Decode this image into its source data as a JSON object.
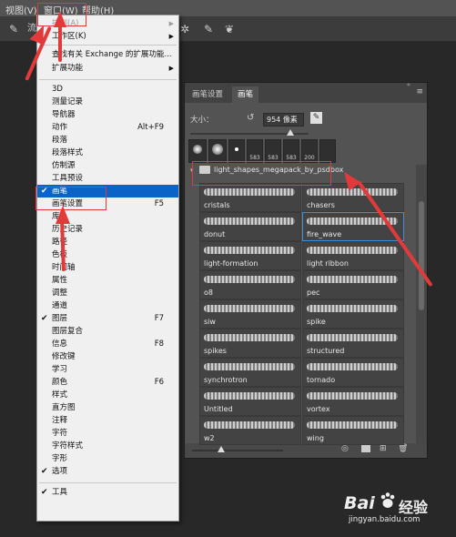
{
  "menubar": {
    "items": [
      "视图(V)",
      "窗口(W)",
      "帮助(H)"
    ]
  },
  "options_bar": {
    "partial_label": "流"
  },
  "menu": {
    "items": [
      {
        "label": "排列(A)",
        "shortcut": "",
        "submenu": true,
        "disabled": true,
        "checked": false,
        "selected": false
      },
      {
        "label": "工作区(K)",
        "shortcut": "",
        "submenu": true,
        "disabled": false,
        "checked": false,
        "selected": false
      },
      {
        "label": "查找有关 Exchange 的扩展功能...",
        "shortcut": "",
        "submenu": false,
        "disabled": false,
        "checked": false,
        "selected": false
      },
      {
        "label": "扩展功能",
        "shortcut": "",
        "submenu": true,
        "disabled": false,
        "checked": false,
        "selected": false
      },
      {
        "label": "3D",
        "shortcut": "",
        "submenu": false,
        "disabled": false,
        "checked": false,
        "selected": false
      },
      {
        "label": "测量记录",
        "shortcut": "",
        "submenu": false,
        "disabled": false,
        "checked": false,
        "selected": false
      },
      {
        "label": "导航器",
        "shortcut": "",
        "submenu": false,
        "disabled": false,
        "checked": false,
        "selected": false
      },
      {
        "label": "动作",
        "shortcut": "Alt+F9",
        "submenu": false,
        "disabled": false,
        "checked": false,
        "selected": false
      },
      {
        "label": "段落",
        "shortcut": "",
        "submenu": false,
        "disabled": false,
        "checked": false,
        "selected": false
      },
      {
        "label": "段落样式",
        "shortcut": "",
        "submenu": false,
        "disabled": false,
        "checked": false,
        "selected": false
      },
      {
        "label": "仿制源",
        "shortcut": "",
        "submenu": false,
        "disabled": false,
        "checked": false,
        "selected": false
      },
      {
        "label": "工具预设",
        "shortcut": "",
        "submenu": false,
        "disabled": false,
        "checked": false,
        "selected": false
      },
      {
        "label": "画笔",
        "shortcut": "",
        "submenu": false,
        "disabled": false,
        "checked": true,
        "selected": true
      },
      {
        "label": "画笔设置",
        "shortcut": "F5",
        "submenu": false,
        "disabled": false,
        "checked": false,
        "selected": false
      },
      {
        "label": "库",
        "shortcut": "",
        "submenu": false,
        "disabled": false,
        "checked": false,
        "selected": false
      },
      {
        "label": "历史记录",
        "shortcut": "",
        "submenu": false,
        "disabled": false,
        "checked": false,
        "selected": false
      },
      {
        "label": "路径",
        "shortcut": "",
        "submenu": false,
        "disabled": false,
        "checked": false,
        "selected": false
      },
      {
        "label": "色板",
        "shortcut": "",
        "submenu": false,
        "disabled": false,
        "checked": false,
        "selected": false
      },
      {
        "label": "时间轴",
        "shortcut": "",
        "submenu": false,
        "disabled": false,
        "checked": false,
        "selected": false
      },
      {
        "label": "属性",
        "shortcut": "",
        "submenu": false,
        "disabled": false,
        "checked": false,
        "selected": false
      },
      {
        "label": "调整",
        "shortcut": "",
        "submenu": false,
        "disabled": false,
        "checked": false,
        "selected": false
      },
      {
        "label": "通道",
        "shortcut": "",
        "submenu": false,
        "disabled": false,
        "checked": false,
        "selected": false
      },
      {
        "label": "图层",
        "shortcut": "F7",
        "submenu": false,
        "disabled": false,
        "checked": true,
        "selected": false
      },
      {
        "label": "图层复合",
        "shortcut": "",
        "submenu": false,
        "disabled": false,
        "checked": false,
        "selected": false
      },
      {
        "label": "信息",
        "shortcut": "F8",
        "submenu": false,
        "disabled": false,
        "checked": false,
        "selected": false
      },
      {
        "label": "修改键",
        "shortcut": "",
        "submenu": false,
        "disabled": false,
        "checked": false,
        "selected": false
      },
      {
        "label": "学习",
        "shortcut": "",
        "submenu": false,
        "disabled": false,
        "checked": false,
        "selected": false
      },
      {
        "label": "颜色",
        "shortcut": "F6",
        "submenu": false,
        "disabled": false,
        "checked": false,
        "selected": false
      },
      {
        "label": "样式",
        "shortcut": "",
        "submenu": false,
        "disabled": false,
        "checked": false,
        "selected": false
      },
      {
        "label": "直方图",
        "shortcut": "",
        "submenu": false,
        "disabled": false,
        "checked": false,
        "selected": false
      },
      {
        "label": "注释",
        "shortcut": "",
        "submenu": false,
        "disabled": false,
        "checked": false,
        "selected": false
      },
      {
        "label": "字符",
        "shortcut": "",
        "submenu": false,
        "disabled": false,
        "checked": false,
        "selected": false
      },
      {
        "label": "字符样式",
        "shortcut": "",
        "submenu": false,
        "disabled": false,
        "checked": false,
        "selected": false
      },
      {
        "label": "字形",
        "shortcut": "",
        "submenu": false,
        "disabled": false,
        "checked": false,
        "selected": false
      },
      {
        "label": "选项",
        "shortcut": "",
        "submenu": false,
        "disabled": false,
        "checked": true,
        "selected": false
      },
      {
        "label": "工具",
        "shortcut": "",
        "submenu": false,
        "disabled": false,
        "checked": true,
        "selected": false
      }
    ]
  },
  "panel": {
    "tabs": [
      "画笔设置",
      "画笔"
    ],
    "active_tab": "画笔",
    "size_label": "大小：",
    "size_value": "954 像素",
    "tip_numbers": [
      "583",
      "583",
      "583",
      "200"
    ],
    "folder_name": "light_shapes_megapack_by_psdbox",
    "brushes": [
      "cristals",
      "chasers",
      "donut",
      "fire_wave",
      "light-formation",
      "light ribbon",
      "o8",
      "pec",
      "siw",
      "spike",
      "spikes",
      "structured",
      "synchrotron",
      "tornado",
      "Untitled",
      "vortex",
      "w2",
      "wing"
    ],
    "selected_brush": "fire_wave"
  },
  "watermark": {
    "brand_left": "Bai",
    "brand_right": "经验",
    "url": "jingyan.baidu.com"
  },
  "colors": {
    "menu_bg": "#f0f0f0",
    "menu_selected": "#0a64c8",
    "annotation_red": "#e23a3a",
    "panel_bg": "#535353"
  }
}
